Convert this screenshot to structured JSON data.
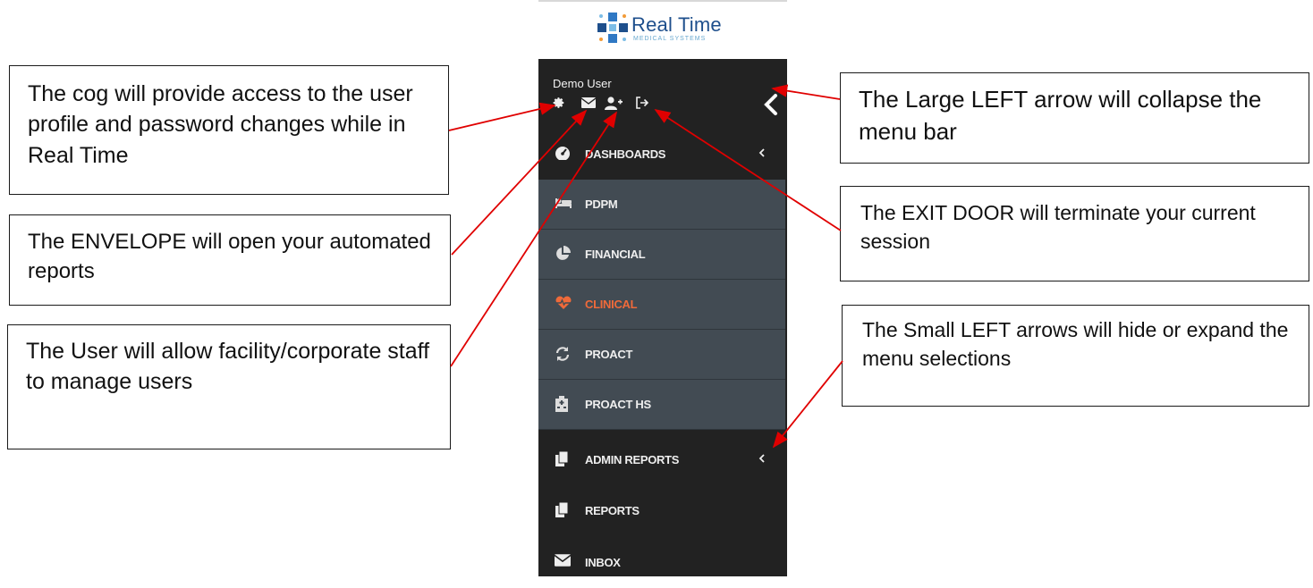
{
  "logo": {
    "brand": "Real Time",
    "tagline": "MEDICAL SYSTEMS"
  },
  "sidebar": {
    "user_name": "Demo User",
    "user_icons": [
      "gear-icon",
      "envelope-icon",
      "user-plus-icon",
      "sign-out-icon"
    ],
    "collapse_icon": "chevron-left-icon",
    "items": [
      {
        "label": "DASHBOARDS",
        "icon": "dashboard-gauge-icon",
        "has_chevron": true,
        "level": 0
      },
      {
        "label": "PDPM",
        "icon": "bed-icon",
        "level": 1
      },
      {
        "label": "FINANCIAL",
        "icon": "pie-chart-icon",
        "level": 1
      },
      {
        "label": "CLINICAL",
        "icon": "heartbeat-icon",
        "level": 1,
        "active": true
      },
      {
        "label": "PROACT",
        "icon": "refresh-icon",
        "level": 1
      },
      {
        "label": "PROACT HS",
        "icon": "hospital-icon",
        "level": 1
      },
      {
        "label": "ADMIN REPORTS",
        "icon": "copy-icon",
        "has_chevron": true,
        "level": 0
      },
      {
        "label": "REPORTS",
        "icon": "copy-icon",
        "level": 0
      },
      {
        "label": "INBOX",
        "icon": "envelope-icon",
        "level": 0
      }
    ]
  },
  "callouts": {
    "cog": "The cog will provide access to the user profile and password changes while in Real Time",
    "envelope": "The ENVELOPE will open your automated reports",
    "user": "The User will allow facility/corporate staff to manage users",
    "large_arrow": "The Large LEFT arrow will collapse the menu bar",
    "exit_door": "The EXIT DOOR will terminate your current session",
    "small_arrows": "The Small LEFT arrows will hide or expand the menu selections"
  },
  "colors": {
    "sidebar_bg": "#222222",
    "submenu_bg": "#424b53",
    "active_text": "#ef6a3a",
    "brand_blue": "#1e4f8c",
    "arrow_red": "#e00000"
  }
}
